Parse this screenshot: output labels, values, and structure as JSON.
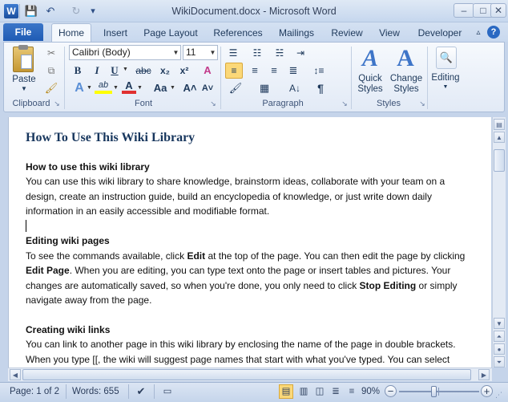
{
  "window": {
    "title": "WikiDocument.docx - Microsoft Word",
    "app_icon": "W"
  },
  "quick_access": {
    "save_icon": "💾",
    "undo_icon": "↶",
    "redo_icon": "↻",
    "customize_icon": "▾"
  },
  "window_controls": {
    "minimize": "–",
    "maximize": "□",
    "close": "✕"
  },
  "tabs": [
    "File",
    "Home",
    "Insert",
    "Page Layout",
    "References",
    "Mailings",
    "Review",
    "View",
    "Developer"
  ],
  "ribbon": {
    "clipboard": {
      "label": "Clipboard",
      "paste": "Paste"
    },
    "font": {
      "label": "Font",
      "font_name": "Calibri (Body)",
      "font_size": "11",
      "bold": "B",
      "italic": "I",
      "underline": "U",
      "strike": "abc",
      "subscript": "x₂",
      "superscript": "x²",
      "grow": "A˄",
      "shrink": "A˅",
      "change_case": "Aa",
      "highlight": "ab",
      "font_color": "A",
      "clear": "A"
    },
    "paragraph": {
      "label": "Paragraph",
      "pilcrow": "¶"
    },
    "styles": {
      "label": "Styles",
      "quick_styles": "Quick Styles",
      "change_styles": "Change Styles"
    },
    "editing": {
      "label": "Editing"
    }
  },
  "document": {
    "heading": "How To Use This Wiki Library",
    "s1_title": "How to use this wiki library",
    "s1_l1": "You can use this wiki library to share knowledge, brainstorm ideas, collaborate with your team on a",
    "s1_l2": "design, create an instruction guide, build an encyclopedia of knowledge, or just write down daily",
    "s1_l3": "information in an easily accessible and modifiable format.",
    "s2_title": "Editing wiki pages",
    "s2_l1a": "To see the commands available, click ",
    "s2_l1b": "Edit",
    "s2_l1c": " at the top of the page. You can then edit the page by clicking",
    "s2_l2a": "Edit Page",
    "s2_l2b": ". When you are editing, you can type text onto the page or insert tables and pictures. Your",
    "s2_l3a": "changes are automatically saved, so when you're done, you only need to click ",
    "s2_l3b": "Stop Editing",
    "s2_l3c": " or simply",
    "s2_l4": "navigate away from the page.",
    "s3_title": "Creating wiki links",
    "s3_l1": "You can link to another page in this wiki library by enclosing the name of the page in double brackets.",
    "s3_l2": "When you type [[, the wiki will suggest page names that start with what you've typed. You can select"
  },
  "status": {
    "page": "Page: 1 of 2",
    "words": "Words: 655",
    "zoom": "90%",
    "zoom_level": 0.9
  }
}
